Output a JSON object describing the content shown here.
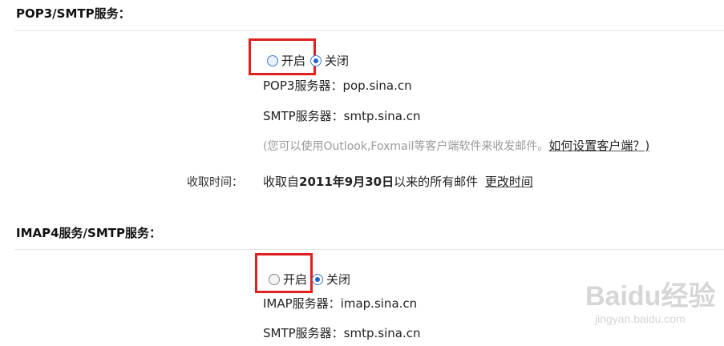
{
  "pop_section": {
    "title": "POP3/SMTP服务：",
    "radio_on_label": "开启",
    "radio_off_label": "关闭",
    "pop_server_label": "POP3服务器：",
    "pop_server_value": "pop.sina.cn",
    "smtp_server_label": "SMTP服务器：",
    "smtp_server_value": "smtp.sina.cn",
    "hint_text": "(您可以使用Outlook,Foxmail等客户端软件来收发邮件。",
    "help_link": "如何设置客户端？)",
    "fetch_time_label": "收取时间：",
    "fetch_prefix": "收取自",
    "fetch_date": "2011年9月30日",
    "fetch_suffix": "以来的所有邮件",
    "change_time_link": "更改时间"
  },
  "imap_section": {
    "title": "IMAP4服务/SMTP服务：",
    "radio_on_label": "开启",
    "radio_off_label": "关闭",
    "imap_server_label": "IMAP服务器：",
    "imap_server_value": "imap.sina.cn",
    "smtp_server_label": "SMTP服务器：",
    "smtp_server_value": "smtp.sina.cn"
  },
  "watermark": {
    "brand": "Baidu经验",
    "url": "jingyan.baidu.com"
  },
  "colors": {
    "highlight": "#e02020",
    "radio_checked": "#1e64c8",
    "hint_gray": "#9a9a9a"
  }
}
